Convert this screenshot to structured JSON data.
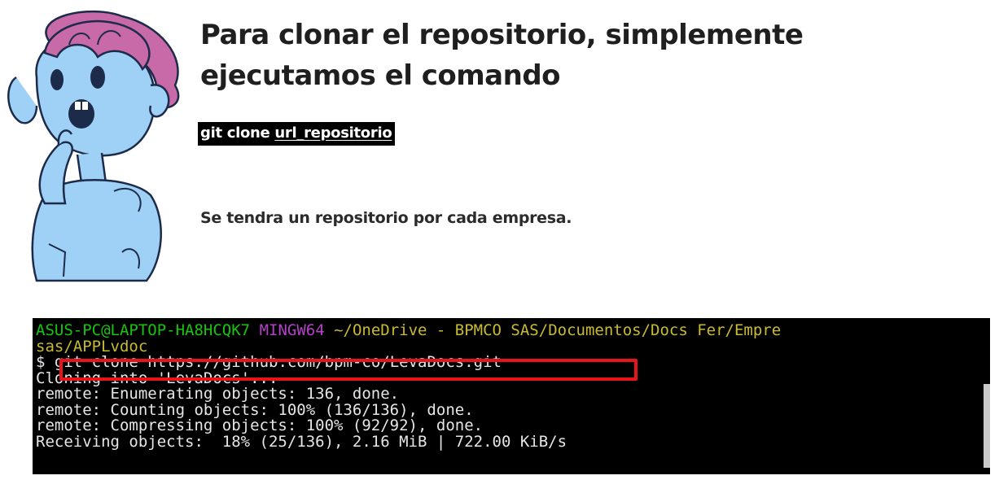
{
  "heading": "Para clonar el repositorio, simplemente ejecutamos el comando",
  "command": {
    "prefix": "git clone ",
    "argument": "url_repositorio"
  },
  "note": "Se tendra un repositorio por cada empresa.",
  "terminal": {
    "prompt_user": "ASUS-PC@LAPTOP-HA8HCQK7",
    "prompt_system": "MINGW64",
    "prompt_path_line1": "~/OneDrive - BPMCO SAS/Documentos/Docs Fer/Empre",
    "prompt_path_line2": "sas/APPLvdoc",
    "prompt_symbol": "$",
    "command_text": "git clone https://github.com/bpm-co/LevaDocs.git",
    "output_lines": [
      "Cloning into 'LevaDocs'...",
      "remote: Enumerating objects: 136, done.",
      "remote: Counting objects: 100% (136/136), done.",
      "remote: Compressing objects: 100% (92/92), done.",
      "Receiving objects:  18% (25/136), 2.16 MiB | 722.00 KiB/s"
    ]
  },
  "colors": {
    "terminal_bg": "#000000",
    "user": "#16c60c",
    "system": "#b540c8",
    "path": "#c9bb31",
    "highlight_border": "#e8141b"
  }
}
